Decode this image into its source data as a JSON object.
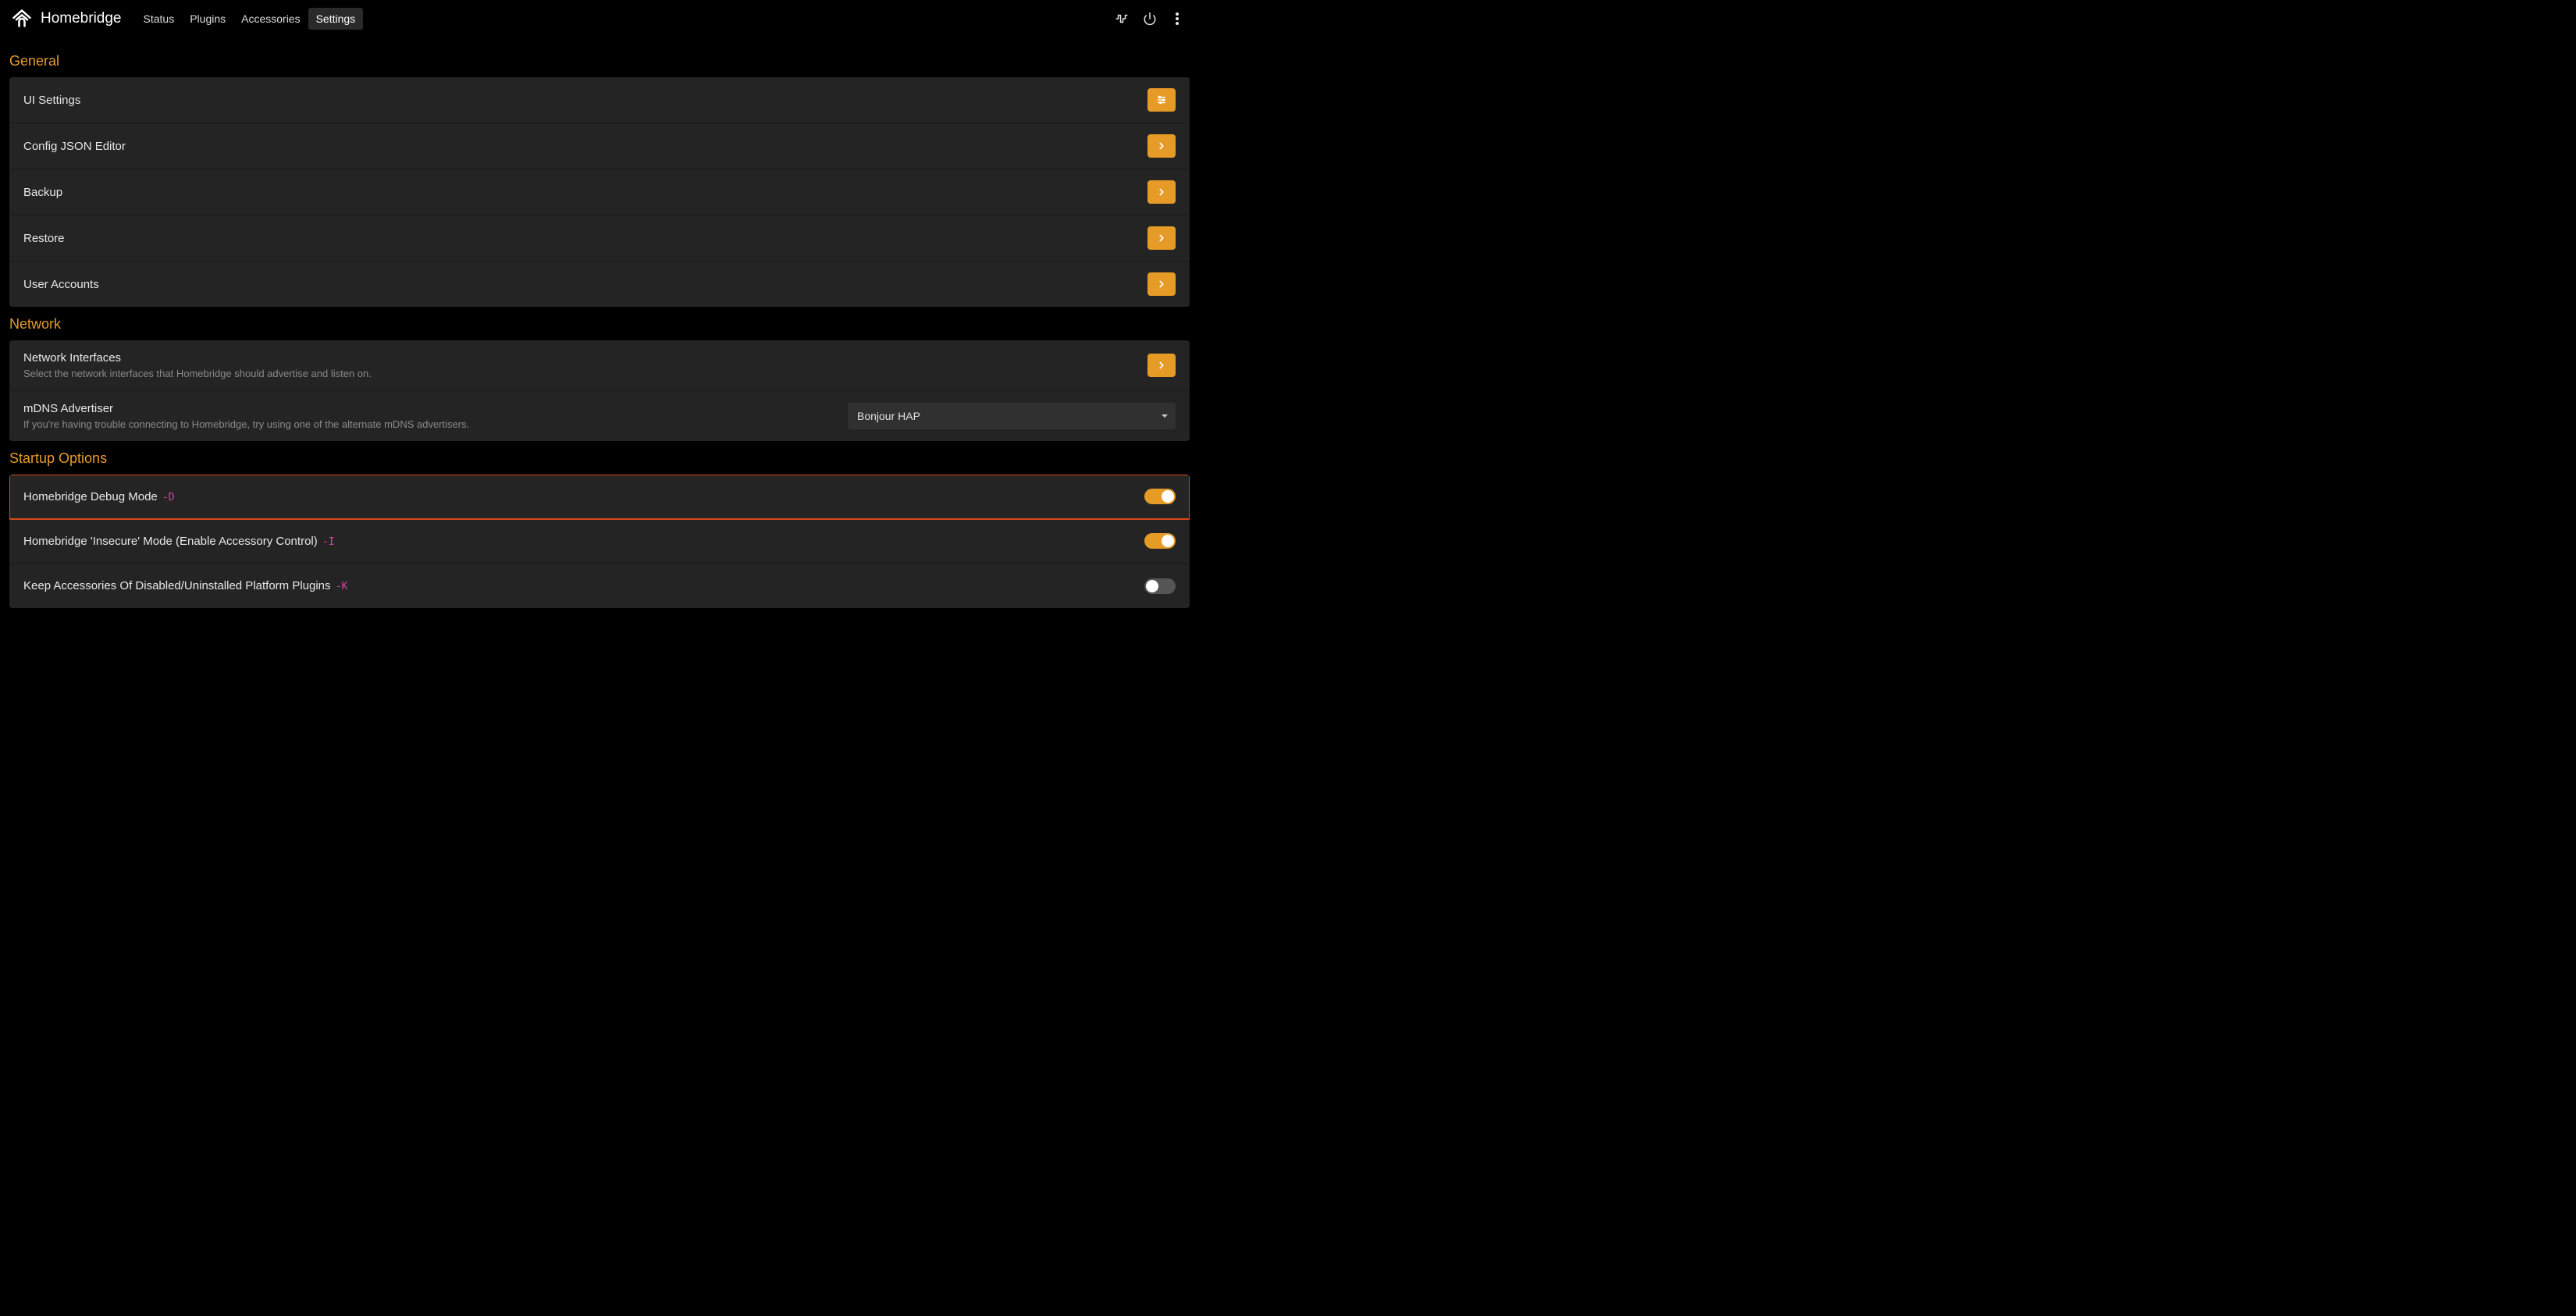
{
  "brand": {
    "title": "Homebridge"
  },
  "nav": {
    "links": [
      "Status",
      "Plugins",
      "Accessories",
      "Settings"
    ],
    "activeIndex": 3
  },
  "sections": {
    "general": {
      "title": "General",
      "items": [
        {
          "label": "UI Settings",
          "action": "sliders"
        },
        {
          "label": "Config JSON Editor",
          "action": "chevron"
        },
        {
          "label": "Backup",
          "action": "chevron"
        },
        {
          "label": "Restore",
          "action": "chevron"
        },
        {
          "label": "User Accounts",
          "action": "chevron"
        }
      ]
    },
    "network": {
      "title": "Network",
      "interfaces": {
        "label": "Network Interfaces",
        "sub": "Select the network interfaces that Homebridge should advertise and listen on."
      },
      "mdns": {
        "label": "mDNS Advertiser",
        "sub": "If you're having trouble connecting to Homebridge, try using one of the alternate mDNS advertisers.",
        "selected": "Bonjour HAP"
      }
    },
    "startup": {
      "title": "Startup Options",
      "items": [
        {
          "label": "Homebridge Debug Mode ",
          "flag": "-D",
          "on": true,
          "highlight": true
        },
        {
          "label": "Homebridge 'Insecure' Mode (Enable Accessory Control) ",
          "flag": "-I",
          "on": true,
          "highlight": false
        },
        {
          "label": "Keep Accessories Of Disabled/Uninstalled Platform Plugins ",
          "flag": "-K",
          "on": false,
          "highlight": false
        }
      ]
    }
  }
}
